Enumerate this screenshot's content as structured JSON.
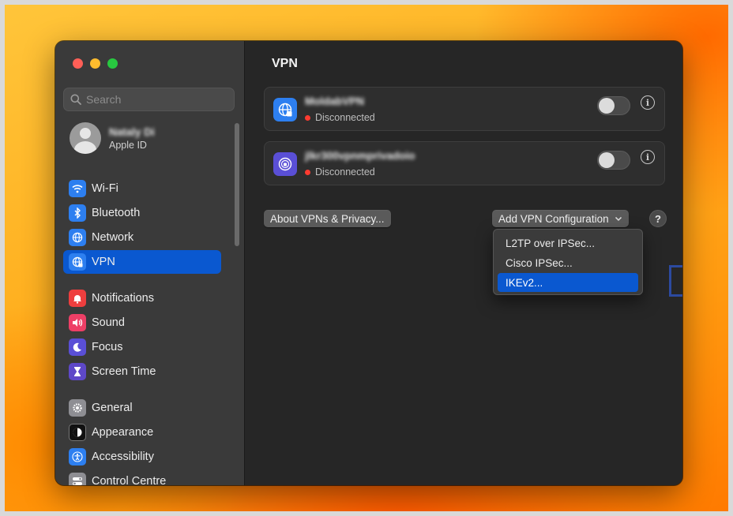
{
  "search": {
    "placeholder": "Search"
  },
  "profile": {
    "name": "Nataly Di",
    "subtitle": "Apple ID"
  },
  "sidebar": {
    "items": [
      {
        "label": "Wi-Fi",
        "icon": "wifi-icon"
      },
      {
        "label": "Bluetooth",
        "icon": "bluetooth-icon"
      },
      {
        "label": "Network",
        "icon": "globe-icon"
      },
      {
        "label": "VPN",
        "icon": "vpn-globe-icon",
        "active": true
      },
      {
        "label": "Notifications",
        "icon": "bell-icon"
      },
      {
        "label": "Sound",
        "icon": "speaker-icon"
      },
      {
        "label": "Focus",
        "icon": "moon-icon"
      },
      {
        "label": "Screen Time",
        "icon": "hourglass-icon"
      },
      {
        "label": "General",
        "icon": "gear-icon"
      },
      {
        "label": "Appearance",
        "icon": "appearance-icon"
      },
      {
        "label": "Accessibility",
        "icon": "accessibility-icon"
      },
      {
        "label": "Control Centre",
        "icon": "control-centre-icon"
      }
    ]
  },
  "main": {
    "title": "VPN",
    "vpns": [
      {
        "name": "MoldabVPN",
        "status": "Disconnected"
      },
      {
        "name": "jlkr300vpnmprivadoio",
        "status": "Disconnected"
      }
    ],
    "about_button": "About VPNs & Privacy...",
    "add_button": "Add VPN Configuration",
    "help": "?"
  },
  "menu": {
    "items": [
      "L2TP over IPSec...",
      "Cisco IPSec...",
      "IKEv2..."
    ],
    "selected": "IKEv2..."
  },
  "colors": {
    "accent": "#0a58d0",
    "status_disconnected": "#ff3b30",
    "annotation_box": "#2c4aa0"
  }
}
